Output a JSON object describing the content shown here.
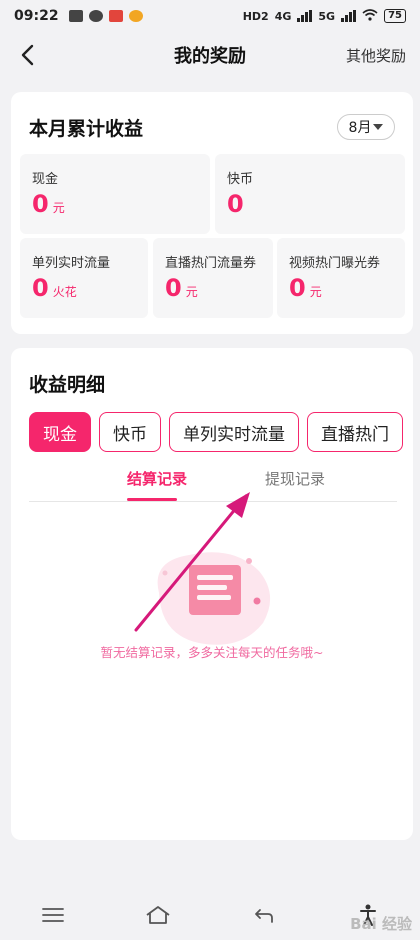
{
  "status_bar": {
    "time": "09:22",
    "hd": "HD2",
    "net1": "4G",
    "net2": "5G",
    "battery": "75"
  },
  "header": {
    "title": "我的奖励",
    "right_link": "其他奖励"
  },
  "earnings": {
    "title": "本月累计收益",
    "month": "8月",
    "cash": {
      "label": "现金",
      "value": "0",
      "unit": "元"
    },
    "coins": {
      "label": "快币",
      "value": "0"
    },
    "single_flow": {
      "label": "单列实时流量",
      "value": "0",
      "unit": "火花"
    },
    "live_hot": {
      "label": "直播热门流量券",
      "value": "0",
      "unit": "元"
    },
    "video_hot": {
      "label": "视频热门曝光券",
      "value": "0",
      "unit": "元"
    }
  },
  "details": {
    "title": "收益明细",
    "pills": [
      "现金",
      "快币",
      "单列实时流量",
      "直播热门"
    ],
    "active_pill": "现金",
    "subtabs": [
      "结算记录",
      "提现记录"
    ],
    "active_subtab": "结算记录",
    "empty_text": "暂无结算记录，多多关注每天的任务哦~"
  },
  "watermark": "Bai 经验",
  "colors": {
    "accent": "#f5266c",
    "annotation_arrow": "#d6197a"
  }
}
